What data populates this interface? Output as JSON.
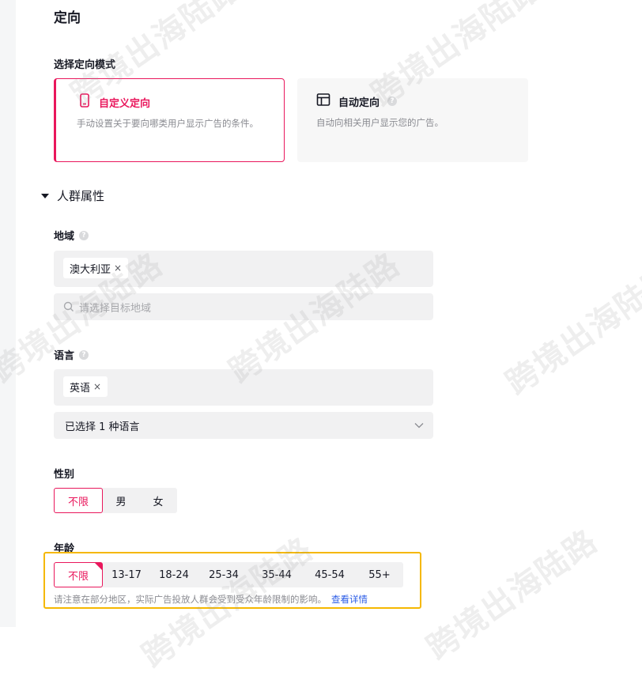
{
  "section": {
    "title": "定向"
  },
  "mode": {
    "label": "选择定向模式",
    "custom": {
      "title": "自定义定向",
      "desc": "手动设置关于要向哪类用户显示广告的条件。"
    },
    "auto": {
      "title": "自动定向",
      "desc": "自动向相关用户显示您的广告。"
    }
  },
  "audience": {
    "title": "人群属性"
  },
  "region": {
    "label": "地域",
    "tags": [
      {
        "label": "澳大利亚",
        "remove": "×"
      }
    ],
    "search_placeholder": "请选择目标地域"
  },
  "language": {
    "label": "语言",
    "tags": [
      {
        "label": "英语",
        "remove": "×"
      }
    ],
    "select_value": "已选择 1 种语言"
  },
  "gender": {
    "label": "性别",
    "options": [
      "不限",
      "男",
      "女"
    ],
    "selected": "不限"
  },
  "age": {
    "label": "年龄",
    "options": [
      "不限",
      "13-17",
      "18-24",
      "25-34",
      "35-44",
      "45-54",
      "55+"
    ],
    "selected": "不限",
    "note": "请注意在部分地区，实际广告投放人群会受到受众年龄限制的影响。",
    "note_link": "查看详情"
  },
  "watermark_text": "跨境出海陆路",
  "colors": {
    "accent": "#e9175c",
    "highlight": "#f5b800",
    "link": "#2b5ce6"
  }
}
